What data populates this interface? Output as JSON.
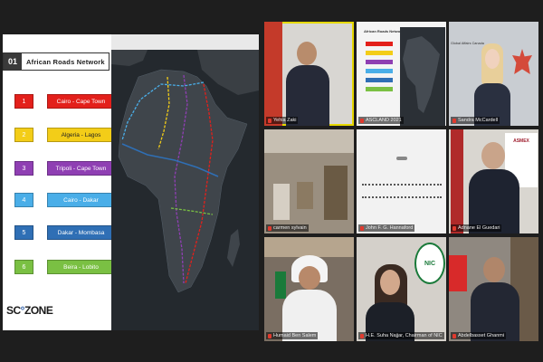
{
  "slide": {
    "number": "01",
    "title": "African Roads Network",
    "routes": [
      {
        "num": "1",
        "name": "Cairo - Cape Town",
        "color": "#e3201b",
        "text": "#ffffff"
      },
      {
        "num": "2",
        "name": "Algeria - Lagos",
        "color": "#f3cd18",
        "text": "#222222"
      },
      {
        "num": "3",
        "name": "Tripoli - Cape Town",
        "color": "#8f3fb3",
        "text": "#ffffff"
      },
      {
        "num": "4",
        "name": "Cairo - Dakar",
        "color": "#4aaee8",
        "text": "#ffffff"
      },
      {
        "num": "5",
        "name": "Dakar - Mombasa",
        "color": "#2f6fb5",
        "text": "#ffffff"
      },
      {
        "num": "6",
        "name": "Beira - Lobito",
        "color": "#7ac043",
        "text": "#ffffff"
      }
    ],
    "logo": "SC",
    "logo_tail": "ZONE"
  },
  "participants": [
    {
      "name": "Yehia Zaki",
      "active": true
    },
    {
      "name": "ASCLAND 2021",
      "active": false
    },
    {
      "name": "Sandra McCardell",
      "active": false
    },
    {
      "name": "carmen sylvain",
      "active": false
    },
    {
      "name": "John F. G. Hannaford",
      "active": false
    },
    {
      "name": "Adnane El Guedari",
      "active": false
    },
    {
      "name": "Humaid Ben Salem",
      "active": false
    },
    {
      "name": "H.E. Suha Najjar, Chairman of NIC",
      "active": false
    },
    {
      "name": "Abdelbasset Ghanmi",
      "active": false
    }
  ],
  "tile_texts": {
    "mini_slide_title": "African Roads Network",
    "ashraf": "ASMEX",
    "nic": "NIC",
    "canada": "Global Affairs Canada"
  }
}
